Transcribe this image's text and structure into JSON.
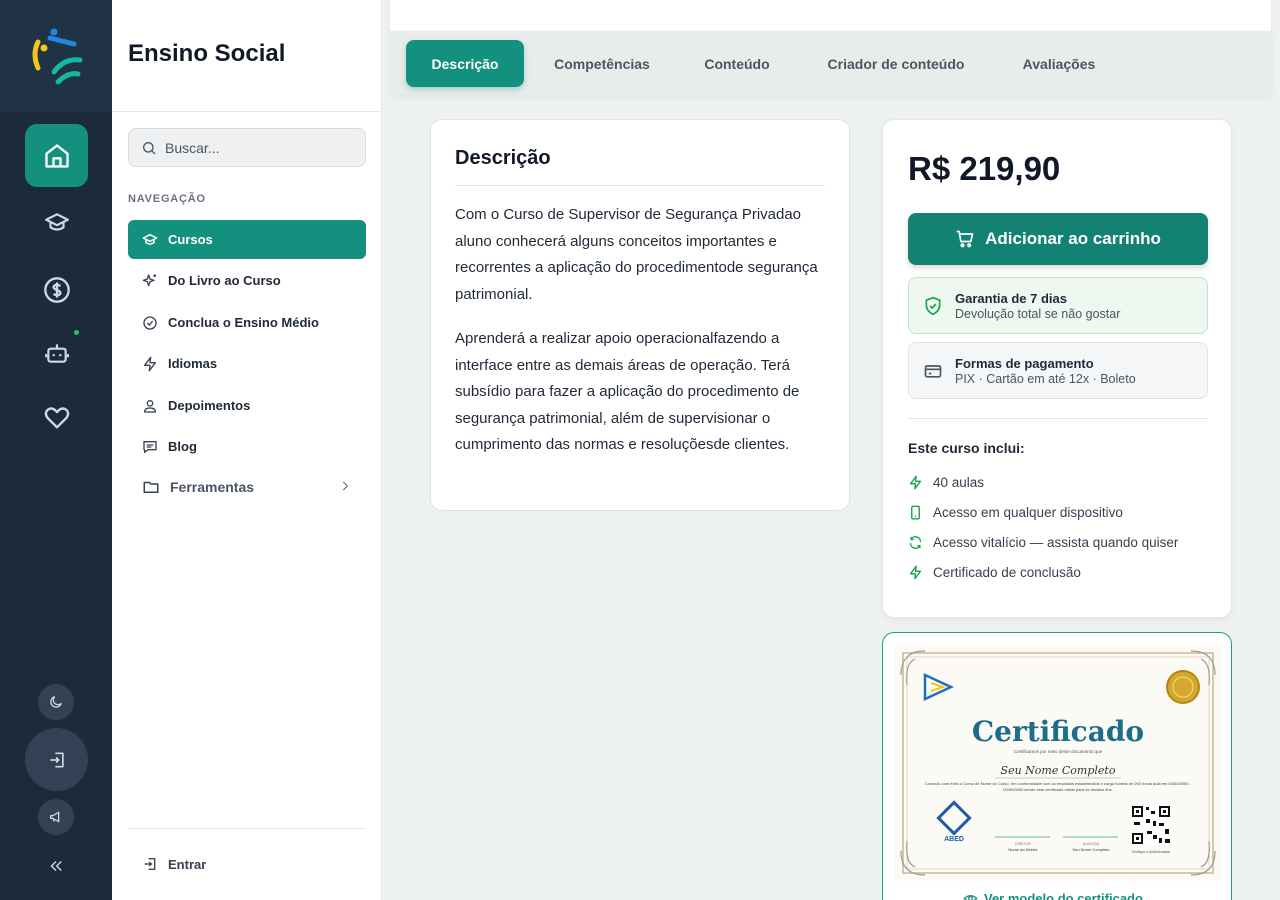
{
  "app": {
    "title": "Ensino Social"
  },
  "search": {
    "placeholder": "Buscar..."
  },
  "nav": {
    "heading": "NAVEGAÇÃO",
    "items": [
      {
        "label": "Cursos",
        "icon": "graduation-cap-icon",
        "active": true
      },
      {
        "label": "Do Livro ao Curso",
        "icon": "sparkles-icon"
      },
      {
        "label": "Conclua o Ensino Médio",
        "icon": "check-circle-icon"
      },
      {
        "label": "Idiomas",
        "icon": "lightning-icon"
      },
      {
        "label": "Depoimentos",
        "icon": "users-icon"
      },
      {
        "label": "Blog",
        "icon": "message-square-icon"
      },
      {
        "label": "Ferramentas",
        "icon": "folder-icon"
      }
    ],
    "login": "Entrar"
  },
  "tabs": [
    "Descrição",
    "Competências",
    "Conteúdo",
    "Criador de conteúdo",
    "Avaliações"
  ],
  "description": {
    "title": "Descrição",
    "paragraphs": [
      "Com o Curso de Supervisor de Segurança Privadao aluno conhecerá alguns conceitos importantes e recorrentes a aplicação do procedimentode segurança patrimonial.",
      "Aprenderá a realizar apoio operacionalfazendo a interface entre as demais áreas de operação. Terá subsídio para fazer a aplicação do procedimento de segurança patrimonial, além de supervisionar o cumprimento das normas e resoluçõesde clientes."
    ]
  },
  "purchase": {
    "price": "R$ 219,90",
    "cart_label": "Adicionar ao carrinho",
    "guarantee": {
      "title": "Garantia de 7 dias",
      "subtitle": "Devolução total se não gostar"
    },
    "payment": {
      "title": "Formas de pagamento",
      "subtitle": "PIX · Cartão em até 12x · Boleto"
    },
    "includes_title": "Este curso inclui:",
    "includes": [
      {
        "label": "40 aulas",
        "icon": "lightning-icon"
      },
      {
        "label": "Acesso em qualquer dispositivo",
        "icon": "smartphone-icon"
      },
      {
        "label": "Acesso vitalício — assista quando quiser",
        "icon": "refresh-icon"
      },
      {
        "label": "Certificado de conclusão",
        "icon": "lightning-icon"
      }
    ]
  },
  "certificate": {
    "heading": "Certificado",
    "line1": "Certificamos por meio deste documento que",
    "name": "Seu Nome Completo",
    "body": "Concluiu com êxito o Curso de Nome do Curso, em conformidade com os requisitos estabelecidos e carga horária de 000 horas aula em 00/00/0000 - 00/00/0000 sendo este certificado válido para os devidos fins.",
    "partner": "ABED",
    "director_role": "DIRETOR",
    "director_name": "Nome do Diretor",
    "student_role": "ALUNO(A)",
    "student_name": "Seu Nome Completo",
    "verify": "Verifique a Autenticidade",
    "link": "Ver modelo do certificado"
  },
  "colors": {
    "primary": "#14907f",
    "rail": "#1c2b3c",
    "success": "#16a34a"
  }
}
